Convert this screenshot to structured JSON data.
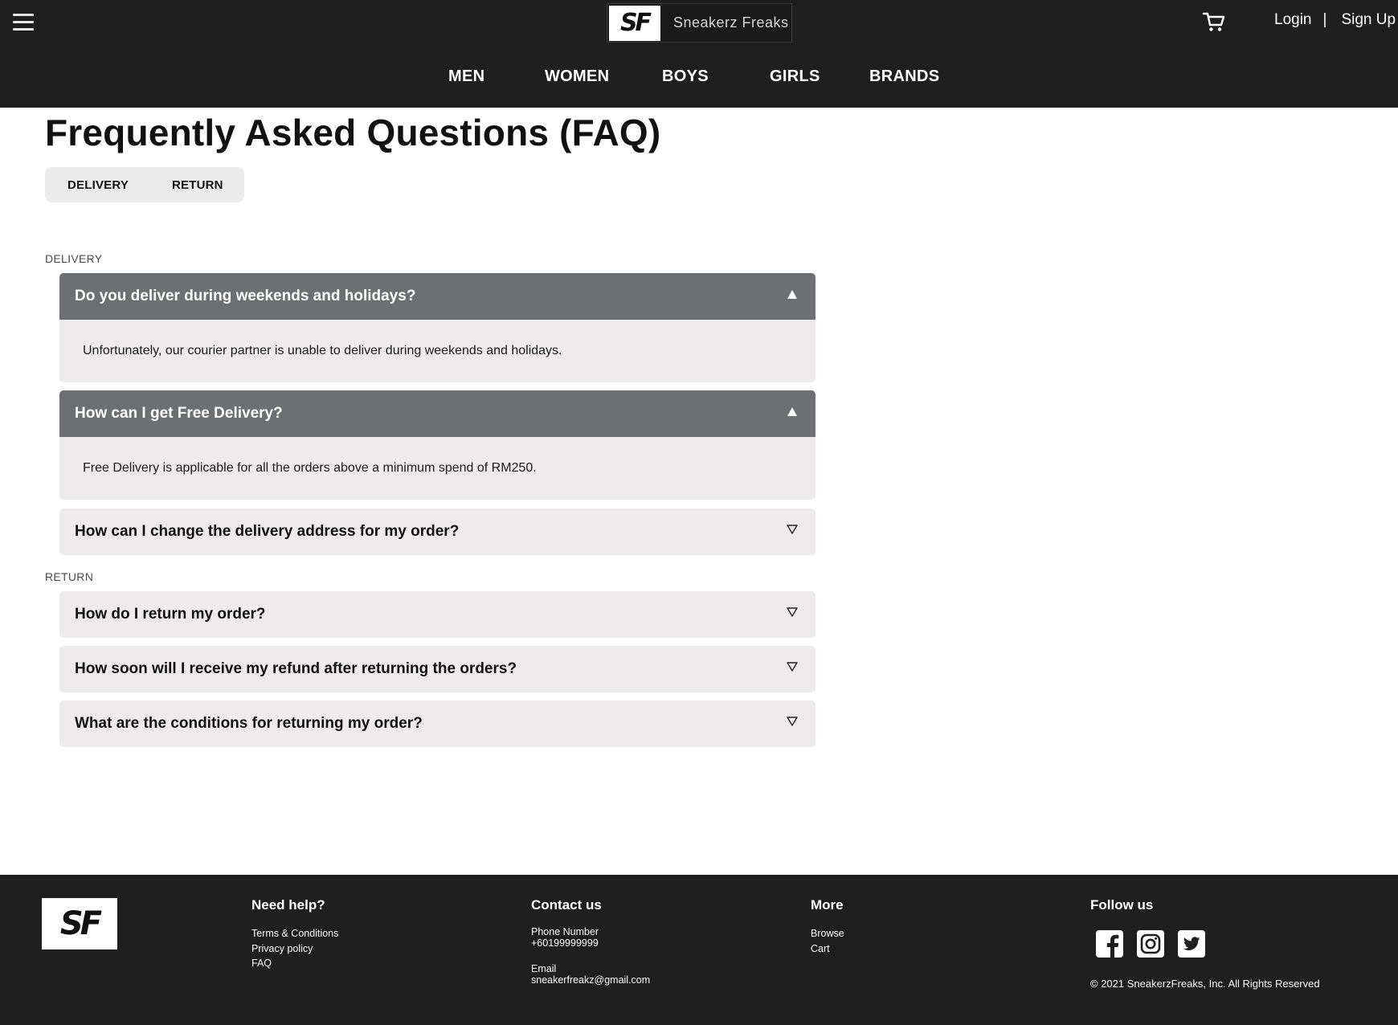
{
  "header": {
    "brand": {
      "mark": "SF",
      "name": "Sneakerz Freaks"
    },
    "auth": {
      "login": "Login",
      "separator": "|",
      "signup": "Sign Up"
    },
    "nav": [
      "MEN",
      "WOMEN",
      "BOYS",
      "GIRLS",
      "BRANDS"
    ]
  },
  "main": {
    "title": "Frequently Asked Questions (FAQ)",
    "tabs": [
      "DELIVERY",
      "RETURN"
    ],
    "sections": [
      {
        "label": "DELIVERY",
        "items": [
          {
            "question": "Do you deliver during weekends and holidays?",
            "answer": "Unfortunately, our courier partner is unable to deliver during weekends and holidays.",
            "expanded": true
          },
          {
            "question": "How can I get Free Delivery?",
            "answer": "Free Delivery is applicable for all the orders above a minimum spend of RM250.",
            "expanded": true
          },
          {
            "question": "How can I change the delivery address for my order?",
            "expanded": false
          }
        ]
      },
      {
        "label": "RETURN",
        "items": [
          {
            "question": "How do I return my order?",
            "expanded": false
          },
          {
            "question": "How soon will I receive my refund after returning the orders?",
            "expanded": false
          },
          {
            "question": "What are the conditions for returning my order?",
            "expanded": false
          }
        ]
      }
    ]
  },
  "footer": {
    "logo": "SF",
    "help": {
      "heading": "Need help?",
      "links": [
        "Terms & Conditions",
        "Privacy policy",
        "FAQ"
      ]
    },
    "contact": {
      "heading": "Contact us",
      "phone_label": "Phone Number",
      "phone": "+60199999999",
      "email_label": "Email",
      "email": "sneakerfreakz@gmail.com"
    },
    "more": {
      "heading": "More",
      "links": [
        "Browse",
        "Cart"
      ]
    },
    "follow": {
      "heading": "Follow us",
      "icons": [
        "facebook-icon",
        "instagram-icon",
        "twitter-icon"
      ]
    },
    "copyright": "© 2021 SneakerzFreaks, Inc. All Rights Reserved"
  },
  "colors": {
    "header_bg": "#1f1f20",
    "open_question_bg": "#6e6f73",
    "faq_bg": "#edebec",
    "tab_bg": "#ebebeb"
  }
}
